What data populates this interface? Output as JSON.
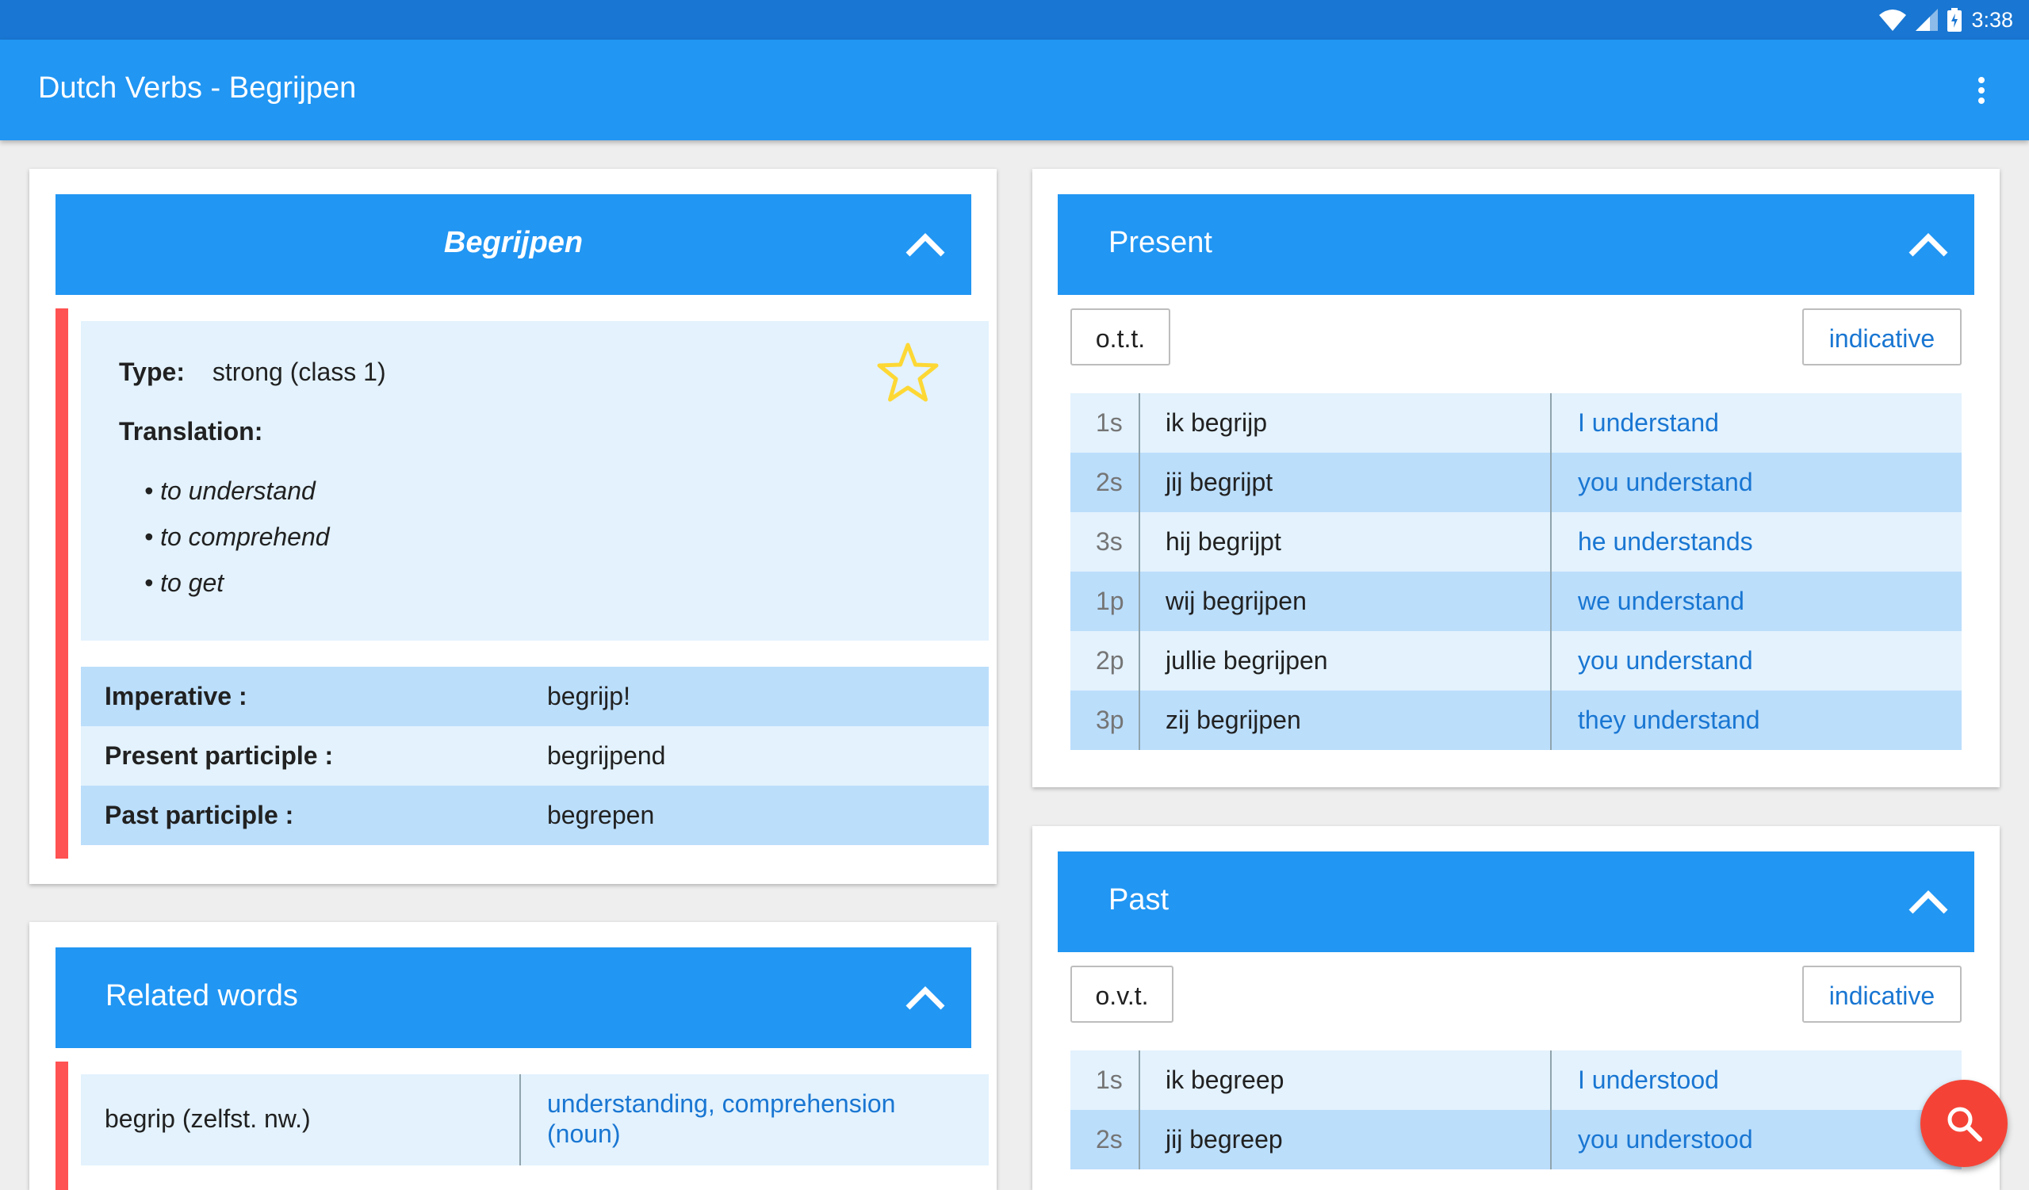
{
  "status": {
    "time": "3:38"
  },
  "app": {
    "title": "Dutch Verbs - Begrijpen"
  },
  "verb_card": {
    "header": "Begrijpen",
    "type_label": "Type:",
    "type_value": "strong (class 1)",
    "translation_label": "Translation:",
    "translations": [
      "to understand",
      "to comprehend",
      "to get"
    ],
    "forms": [
      {
        "label": "Imperative :",
        "value": "begrijp!"
      },
      {
        "label": "Present participle :",
        "value": "begrijpend"
      },
      {
        "label": "Past participle :",
        "value": "begrepen"
      }
    ]
  },
  "related_card": {
    "header": "Related words",
    "rows": [
      {
        "word": "begrip (zelfst. nw.)",
        "meaning": "understanding, comprehension (noun)"
      }
    ]
  },
  "present_card": {
    "header": "Present",
    "tense_chip": "o.t.t.",
    "mood_chip": "indicative",
    "rows": [
      {
        "person": "1s",
        "dutch": "ik begrijp",
        "english": "I understand"
      },
      {
        "person": "2s",
        "dutch": "jij begrijpt",
        "english": "you understand"
      },
      {
        "person": "3s",
        "dutch": "hij begrijpt",
        "english": "he understands"
      },
      {
        "person": "1p",
        "dutch": "wij begrijpen",
        "english": "we understand"
      },
      {
        "person": "2p",
        "dutch": "jullie begrijpen",
        "english": "you understand"
      },
      {
        "person": "3p",
        "dutch": "zij begrijpen",
        "english": "they understand"
      }
    ]
  },
  "past_card": {
    "header": "Past",
    "tense_chip": "o.v.t.",
    "mood_chip": "indicative",
    "rows": [
      {
        "person": "1s",
        "dutch": "ik begreep",
        "english": "I understood"
      },
      {
        "person": "2s",
        "dutch": "jij begreep",
        "english": "you understood"
      }
    ]
  },
  "colors": {
    "primary": "#2196f3",
    "primary_dark": "#1976d2",
    "accent_red": "#ff5252",
    "fab": "#f44336",
    "star": "#fdd835"
  },
  "icons": [
    "wifi-icon",
    "signal-icon",
    "battery-icon",
    "more-vert-icon",
    "chevron-up-icon",
    "star-outline-icon",
    "search-icon"
  ]
}
